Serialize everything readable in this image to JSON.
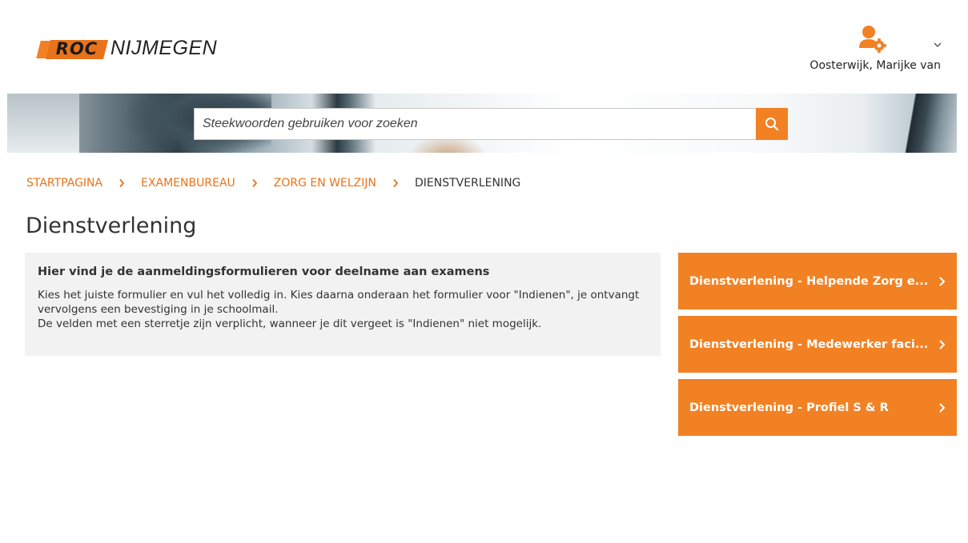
{
  "header": {
    "logo": {
      "mark_text": "ROC",
      "word_text": "NIJMEGEN"
    },
    "user": {
      "name": "Oosterwijk, Marijke van",
      "icon": "user-gear-icon",
      "menu_icon": "chevron-down-icon"
    }
  },
  "search": {
    "placeholder": "Steekwoorden gebruiken voor zoeken",
    "value": "",
    "button_icon": "search-icon"
  },
  "breadcrumb": {
    "items": [
      "STARTPAGINA",
      "EXAMENBUREAU",
      "ZORG EN WELZIJN"
    ],
    "current": "DIENSTVERLENING",
    "separator_icon": "chevron-right-icon"
  },
  "page": {
    "title": "Dienstverlening"
  },
  "info": {
    "heading": "Hier vind je de aanmeldingsformulieren voor deelname aan examens",
    "line1": "Kies het juiste formulier en vul het volledig in. Kies daarna onderaan het formulier voor \"Indienen\", je ontvangt vervolgens een bevestiging in je schoolmail.",
    "line2": "De velden met een sterretje zijn verplicht, wanneer je dit vergeet is \"Indienen\" niet mogelijk."
  },
  "tiles": [
    {
      "label": "Dienstverlening - Helpende Zorg e..."
    },
    {
      "label": "Dienstverlening - Medewerker faci..."
    },
    {
      "label": "Dienstverlening - Profiel S & R"
    }
  ],
  "colors": {
    "accent": "#f28124",
    "link": "#e8731a",
    "panel_bg": "#f2f2f2",
    "text": "#333333"
  }
}
